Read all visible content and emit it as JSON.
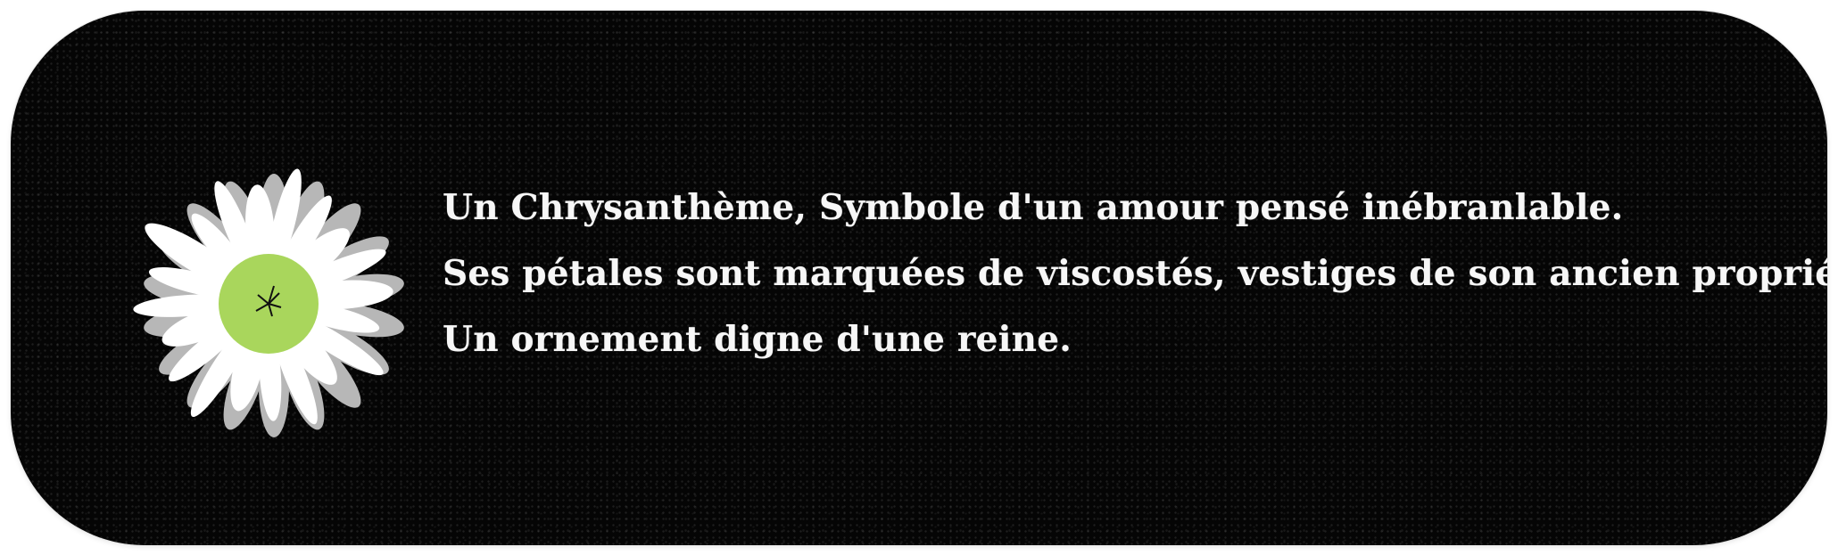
{
  "colors": {
    "panel_background": "#050505",
    "text": "#f7f7f7",
    "petal_front": "#ffffff",
    "petal_back": "#b7b7b7",
    "flower_center": "#a9d65c"
  },
  "icon": {
    "name": "chrysanthemum-icon"
  },
  "text_lines": [
    "Un Chrysanthème, Symbole d'un amour pensé inébranlable.",
    "Ses pétales sont marquées de viscostés, vestiges de son ancien propriétaire.",
    "Un ornement digne d'une reine."
  ]
}
